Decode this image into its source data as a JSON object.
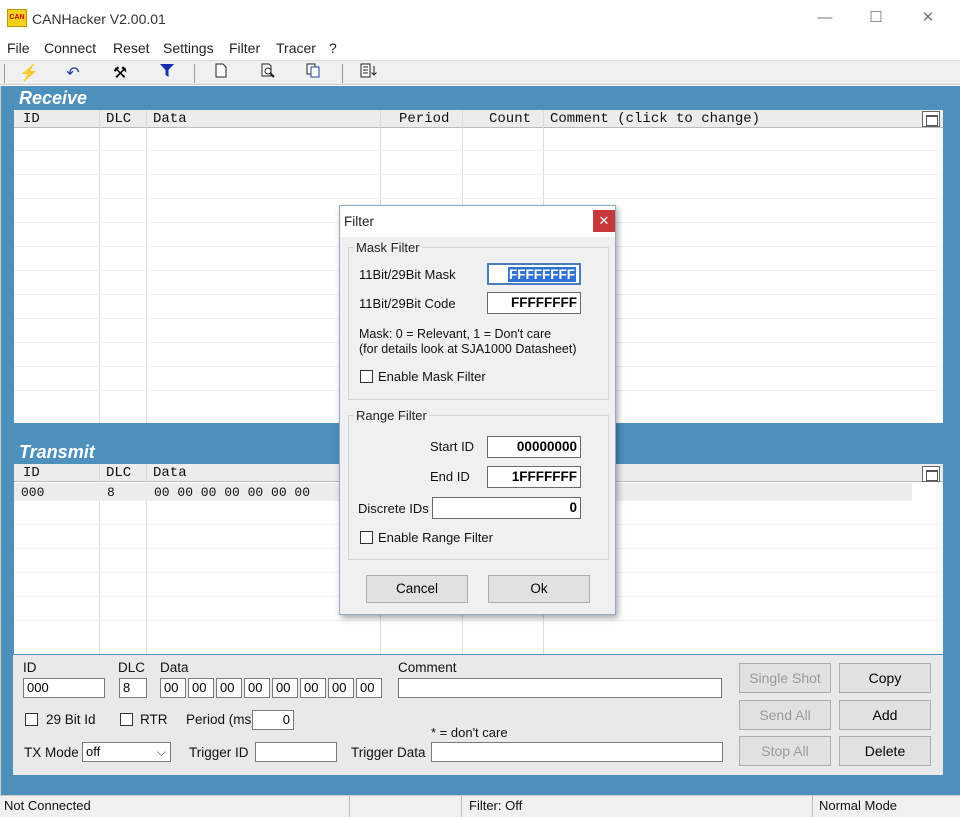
{
  "app": {
    "title": "CANHacker V2.00.01",
    "icon_text": "CAN"
  },
  "window_controls": {
    "minimize": "—",
    "maximize": "☐",
    "close": "✕"
  },
  "menu": [
    "File",
    "Connect",
    "Reset",
    "Settings",
    "Filter",
    "Tracer",
    "?"
  ],
  "toolbar": {
    "icons": [
      "connect-icon",
      "undo-icon",
      "tools-icon",
      "filter-icon",
      "new-file-icon",
      "print-preview-icon",
      "copy-icon",
      "log-icon"
    ]
  },
  "receive": {
    "title": "Receive",
    "columns": [
      "ID",
      "DLC",
      "Data",
      "Period",
      "Count",
      "Comment (click to change)"
    ]
  },
  "transmit": {
    "title": "Transmit",
    "columns": [
      "ID",
      "DLC",
      "Data"
    ],
    "rows": [
      {
        "id": "000",
        "dlc": "8",
        "data": "00 00 00 00 00 00 00"
      }
    ]
  },
  "tx_form": {
    "id_label": "ID",
    "id_value": "000",
    "dlc_label": "DLC",
    "dlc_value": "8",
    "data_label": "Data",
    "data_bytes": [
      "00",
      "00",
      "00",
      "00",
      "00",
      "00",
      "00",
      "00"
    ],
    "comment_label": "Comment",
    "comment_value": "",
    "bit29_label": "29 Bit Id",
    "rtr_label": "RTR",
    "period_label": "Period (ms)",
    "period_value": "0",
    "dont_care_note": "* = don't care",
    "txmode_label": "TX Mode",
    "txmode_value": "off",
    "trigger_id_label": "Trigger ID",
    "trigger_id_value": "",
    "trigger_data_label": "Trigger Data",
    "trigger_data_value": "",
    "single_shot": "Single Shot",
    "send_all": "Send All",
    "stop_all": "Stop All",
    "copy": "Copy",
    "add": "Add",
    "delete": "Delete"
  },
  "status": {
    "connection": "Not Connected",
    "middle": "",
    "filter": "Filter: Off",
    "mode": "Normal Mode"
  },
  "dialog": {
    "title": "Filter",
    "close": "✕",
    "mask_group": "Mask Filter",
    "mask_label": "11Bit/29Bit Mask",
    "mask_value": "FFFFFFFF",
    "code_label": "11Bit/29Bit Code",
    "code_value": "FFFFFFFF",
    "mask_note1": "Mask: 0 = Relevant, 1 = Don't care",
    "mask_note2": "(for details look at SJA1000 Datasheet)",
    "enable_mask": "Enable Mask Filter",
    "range_group": "Range Filter",
    "start_label": "Start ID",
    "start_value": "00000000",
    "end_label": "End ID",
    "end_value": "1FFFFFFF",
    "discrete_label": "Discrete IDs",
    "discrete_value": "0",
    "enable_range": "Enable Range Filter",
    "cancel": "Cancel",
    "ok": "Ok"
  }
}
